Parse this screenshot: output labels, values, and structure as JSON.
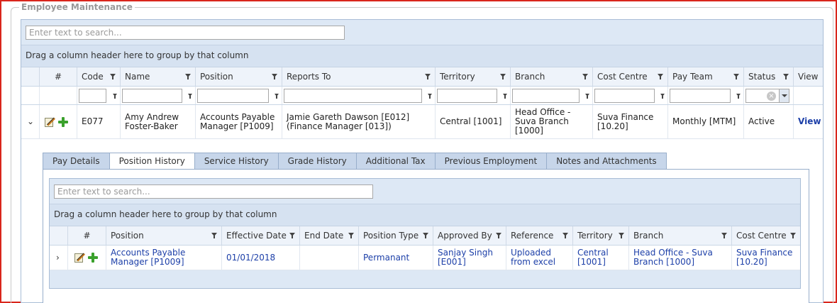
{
  "legend": "Employee Maintenance",
  "outer": {
    "search_placeholder": "Enter text to search...",
    "group_hint": "Drag a column header here to group by that column",
    "columns": [
      "#",
      "Code",
      "Name",
      "Position",
      "Reports To",
      "Territory",
      "Branch",
      "Cost Centre",
      "Pay Team",
      "Status",
      "View"
    ],
    "row": {
      "code": "E077",
      "name": "Amy Andrew Foster-Baker",
      "position": "Accounts Payable Manager [P1009]",
      "reports_to": "Jamie Gareth Dawson [E012] (Finance Manager [013])",
      "territory": "Central [1001]",
      "branch": "Head Office - Suva Branch [1000]",
      "cost_centre": "Suva Finance [10.20]",
      "pay_team": "Monthly [MTM]",
      "status": "Active",
      "view": "View"
    }
  },
  "tabs": [
    "Pay Details",
    "Position History",
    "Service History",
    "Grade History",
    "Additional Tax",
    "Previous Employment",
    "Notes and Attachments"
  ],
  "active_tab": "Position History",
  "inner": {
    "search_placeholder": "Enter text to search...",
    "group_hint": "Drag a column header here to group by that column",
    "columns": [
      "#",
      "Position",
      "Effective Date",
      "End Date",
      "Position Type",
      "Approved By",
      "Reference",
      "Territory",
      "Branch",
      "Cost Centre"
    ],
    "row": {
      "position": "Accounts Payable Manager [P1009]",
      "effective_date": "01/01/2018",
      "end_date": "",
      "position_type": "Permanant",
      "approved_by": "Sanjay Singh [E001]",
      "reference": "Uploaded from excel",
      "territory": "Central [1001]",
      "branch": "Head Office - Suva Branch [1000]",
      "cost_centre": "Suva Finance [10.20]"
    }
  },
  "colors": {
    "accent_link": "#1c3fa8",
    "frame_border": "#d9261c",
    "header_bg": "#eef3fa"
  }
}
